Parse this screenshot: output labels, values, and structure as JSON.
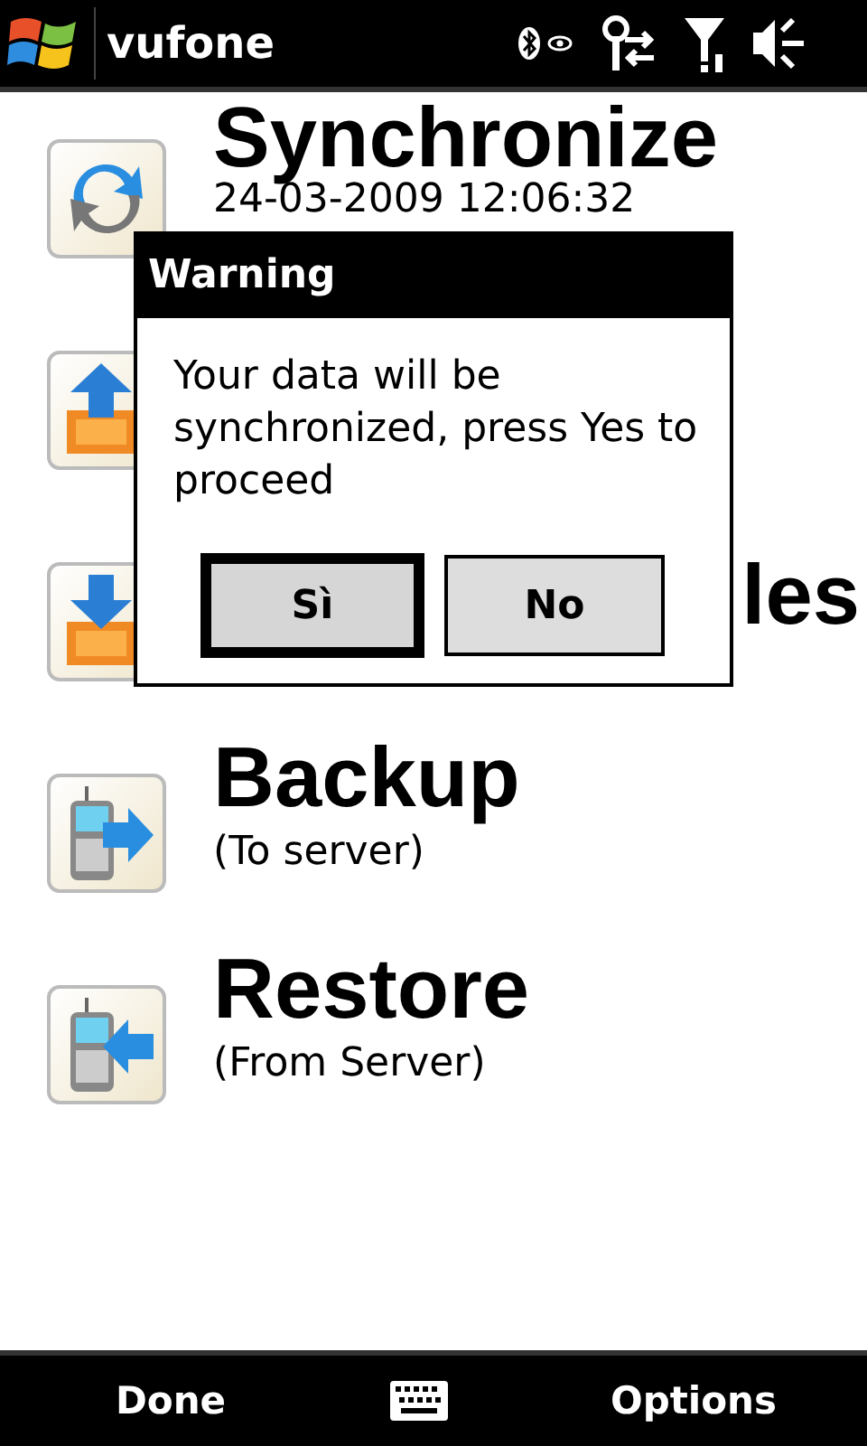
{
  "status_bar": {
    "title": "vufone"
  },
  "items": [
    {
      "kind": "sync",
      "title": "Synchronize",
      "subtitle": "24-03-2009 12:06:32"
    },
    {
      "kind": "upload"
    },
    {
      "kind": "download",
      "title": "les"
    },
    {
      "kind": "backup",
      "title": "Backup",
      "subtitle": "(To server)"
    },
    {
      "kind": "restore",
      "title": "Restore",
      "subtitle": "(From Server)"
    }
  ],
  "dialog": {
    "title": "Warning",
    "message": "Your data will be synchronized, press Yes to proceed",
    "buttons": [
      {
        "label": "Sì",
        "selected": true
      },
      {
        "label": "No",
        "selected": false
      }
    ]
  },
  "softkeys": {
    "left": "Done",
    "right": "Options"
  }
}
